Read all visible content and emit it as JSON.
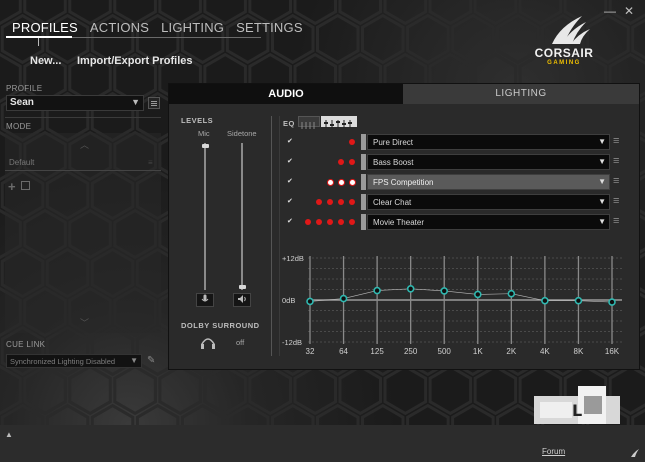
{
  "window": {
    "minimize": "—",
    "close": "✕"
  },
  "nav": {
    "tabs": [
      "PROFILES",
      "ACTIONS",
      "LIGHTING",
      "SETTINGS"
    ],
    "active": "PROFILES",
    "sub": [
      "New...",
      "Import/Export Profiles"
    ]
  },
  "logo": {
    "brand": "CORSAIR",
    "sub": "GAMING"
  },
  "left": {
    "profile_label": "PROFILE",
    "profile_value": "Sean",
    "mode_label": "MODE",
    "mode_item": "Default",
    "cue_link_label": "CUE LINK",
    "cue_link_value": "Synchronized Lighting Disabled"
  },
  "tabs": {
    "audio": "AUDIO",
    "lighting": "LIGHTING"
  },
  "levels": {
    "title": "LEVELS",
    "mic": "Mic",
    "sidetone": "Sidetone",
    "mic_level": 0.98,
    "sidetone_level": 0.02
  },
  "dolby": {
    "title": "DOLBY SURROUND",
    "state": "off"
  },
  "eq": {
    "title": "EQ",
    "presets": [
      {
        "name": "Pure Direct",
        "dots": 1,
        "selected": false,
        "checked": true
      },
      {
        "name": "Bass Boost",
        "dots": 2,
        "selected": false,
        "checked": true
      },
      {
        "name": "FPS Competition",
        "dots": 3,
        "selected": true,
        "checked": true
      },
      {
        "name": "Clear Chat",
        "dots": 4,
        "selected": false,
        "checked": true
      },
      {
        "name": "Movie Theater",
        "dots": 5,
        "selected": false,
        "checked": true
      }
    ]
  },
  "chart_data": {
    "type": "line",
    "categories": [
      "32",
      "64",
      "125",
      "250",
      "500",
      "1K",
      "2K",
      "4K",
      "8K",
      "16K"
    ],
    "values": [
      -0.4,
      0.4,
      2.7,
      3.2,
      2.6,
      1.6,
      1.8,
      -0.2,
      -0.2,
      -0.6
    ],
    "ylim": [
      -12,
      12
    ],
    "yticks": [
      "+12dB",
      "0dB",
      "-12dB"
    ],
    "grid": true
  },
  "footer": {
    "forum": "Forum",
    "expand": "▲"
  },
  "colors": {
    "accent": "#e01818",
    "eq_knob": "#2fb8b0",
    "logo_sub": "#f2c200"
  }
}
